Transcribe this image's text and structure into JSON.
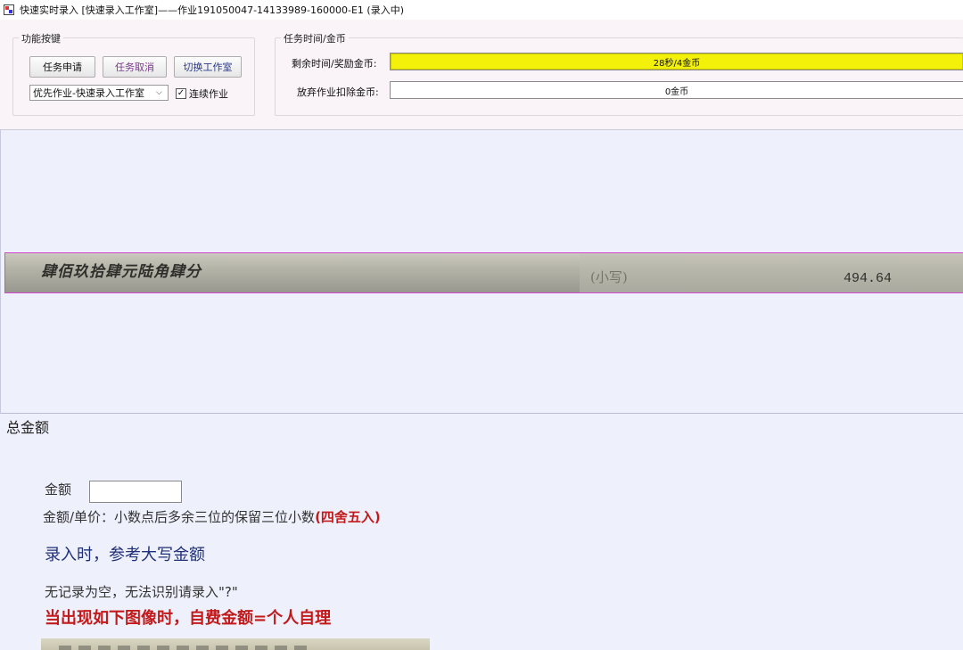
{
  "window": {
    "title": "快速实时录入 [快速录入工作室]——作业191050047-14133989-160000-E1 (录入中)"
  },
  "functions": {
    "group_title": "功能按键",
    "apply_label": "任务申请",
    "cancel_label": "任务取消",
    "switch_label": "切换工作室",
    "studio_select": "优先作业-快速录入工作室",
    "continuous_label": "连续作业",
    "continuous_checked": true
  },
  "task": {
    "group_title": "任务时间/金币",
    "remain_label": "剩余时间/奖励金币:",
    "remain_value": "28秒/4金币",
    "remain_fraction": 1.0,
    "abandon_label": "放弃作业扣除金币:",
    "abandon_value": "0金币"
  },
  "scan": {
    "uppercase_amount": "肆佰玖拾肆元陆角肆分",
    "small_label": "(小写)",
    "numeric_amount": "494.64"
  },
  "form": {
    "section_title": "总金额",
    "amount_label": "金额",
    "amount_value": "",
    "note1_text": "金额/单价：小数点后多余三位的保留三位小数",
    "note1_highlight": "(四舍五入)",
    "note2": "录入时，参考大写金额",
    "note3": "无记录为空，无法识别请录入\"?\"",
    "note4": "当出现如下图像时，自费金额=个人自理"
  },
  "colors": {
    "accent_red": "#c21a1a",
    "accent_blue": "#1f2f7a",
    "progress_yellow": "#f3f10a",
    "selection_border": "#d24ad2"
  }
}
